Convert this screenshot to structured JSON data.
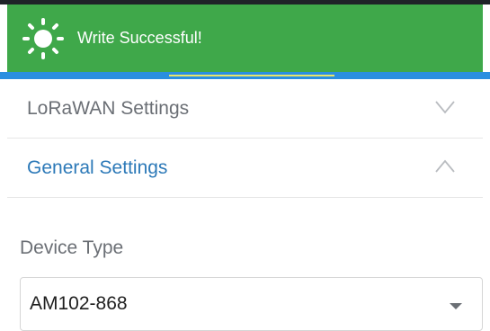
{
  "toast": {
    "message": "Write Successful!",
    "icon": "sun-icon"
  },
  "sections": [
    {
      "label": "LoRaWAN Settings",
      "state": "collapsed",
      "icon": "chevron-down-icon"
    },
    {
      "label": "General Settings",
      "state": "expanded",
      "icon": "chevron-up-icon"
    }
  ],
  "fields": {
    "device_type": {
      "label": "Device Type",
      "value": "AM102-868",
      "icon": "dropdown-caret-icon"
    }
  },
  "colors": {
    "toast_bg": "#3fa84a",
    "active_section": "#2c79b8",
    "muted_text": "#6b6f75",
    "header_blue": "#2a8fe0"
  }
}
